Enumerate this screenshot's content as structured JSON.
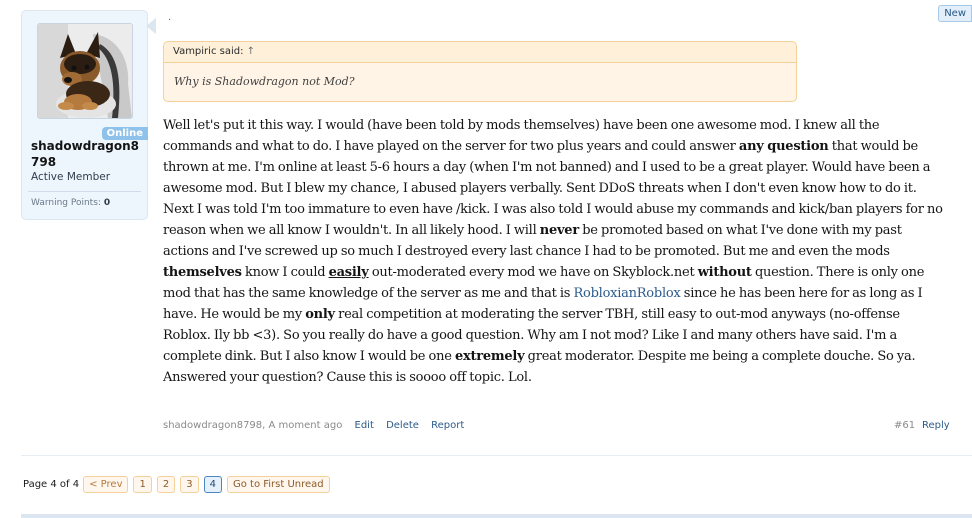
{
  "new_tag": "New",
  "user": {
    "avatar_alt": "German shepherd puppy",
    "status_badge": "Online",
    "name": "shadowdragon8798",
    "title": "Active Member",
    "warning_points_label": "Warning Points:",
    "warning_points_value": "0"
  },
  "dot": ".",
  "quote": {
    "author_label": "Vampiric said:",
    "up_arrow": "↑",
    "text": "Why is Shadowdragon not Mod?"
  },
  "message": {
    "p1": "Well let's put it this way. I would (have been told by mods themselves) have been one awesome mod. I knew all the commands and what to do. I have played on the server for two plus years and could answer ",
    "b1": "any question",
    "p2": " that would be thrown at me. I'm online at least 5-6 hours a day (when I'm not banned) and I used to be a great player. Would have been a awesome mod. But I blew my chance, I abused players verbally. Sent DDoS threats when I don't even know how to do it. Next I was told I'm too immature to even have /kick. I was also told I would abuse my commands and kick/ban players for no reason when we all know I wouldn't. In all likely hood. I will ",
    "b2": "never",
    "p3": " be promoted based on what I've done with my past actions and I've screwed up so much I destroyed every last chance I had to be promoted. But me and even the mods ",
    "b3": "themselves",
    "p4": " know I could ",
    "u1": "easily",
    "p5": " out-moderated every mod we have on Skyblock.net ",
    "b4": "without",
    "p6": " question. There is only one mod that has the same knowledge of the server as me and that is ",
    "link1": "RobloxianRoblox",
    "p7": " since he has been here for as long as I have. He would be my ",
    "b5": "only",
    "p8": " real competition at moderating the server TBH, still easy to out-mod anyways (no-offense Roblox. Ily bb <3). So you really do have a good question. Why am I not mod? Like I and many others have said. I'm a complete dink. But I also know I would be one ",
    "b6": "extremely",
    "p9": " great moderator. Despite me being a complete douche. So ya. Answered your question? Cause this is soooo off topic. Lol."
  },
  "meta": {
    "author_time": "shadowdragon8798, A moment ago",
    "edit": "Edit",
    "delete": "Delete",
    "report": "Report",
    "post_number": "#61",
    "reply": "Reply"
  },
  "pagenav": {
    "label": "Page 4 of 4",
    "prev": "< Prev",
    "pages": [
      "1",
      "2",
      "3",
      "4"
    ],
    "first_unread": "Go to First Unread"
  }
}
